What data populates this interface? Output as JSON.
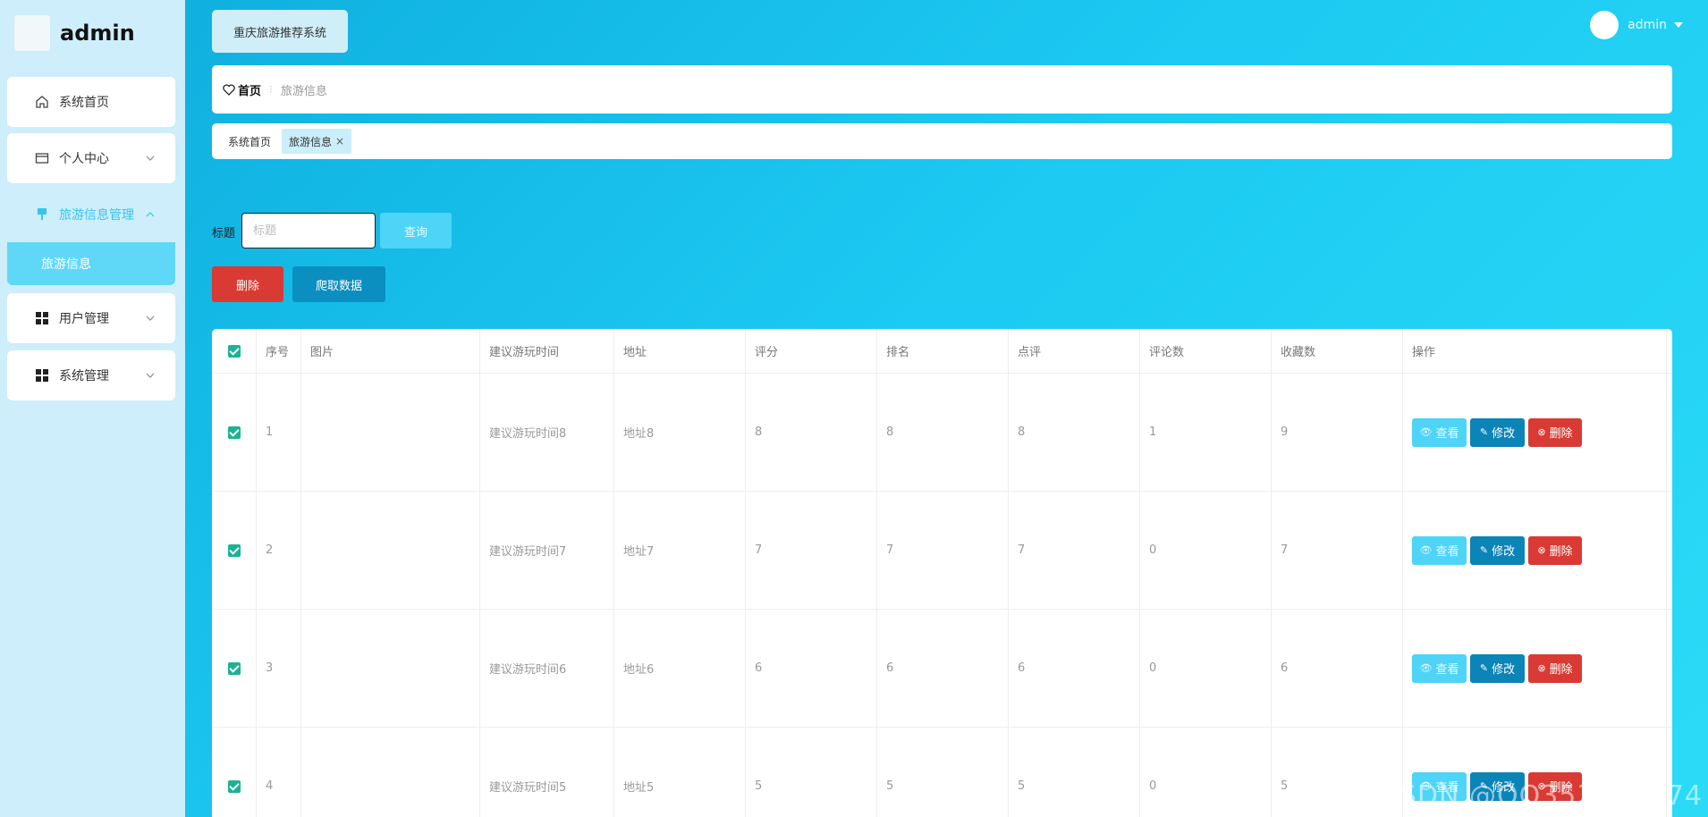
{
  "app": {
    "brand": "admin",
    "system_title": "重庆旅游推荐系统",
    "user_name": "admin"
  },
  "sidebar": {
    "items": [
      {
        "label": "系统首页",
        "icon": "home-icon"
      },
      {
        "label": "个人中心",
        "icon": "wallet-icon"
      },
      {
        "label": "旅游信息管理",
        "icon": "marker-icon"
      },
      {
        "label": "用户管理",
        "icon": "grid-icon"
      },
      {
        "label": "系统管理",
        "icon": "grid-icon"
      }
    ],
    "sub_item": "旅游信息"
  },
  "breadcrumb": {
    "home": "首页",
    "current": "旅游信息"
  },
  "tags": {
    "home": "系统首页",
    "active": "旅游信息",
    "close": "×"
  },
  "search": {
    "label": "标题",
    "placeholder": "标题",
    "query_btn": "查询"
  },
  "actions": {
    "delete": "删除",
    "crawl": "爬取数据"
  },
  "table": {
    "headers": [
      "序号",
      "图片",
      "建议游玩时间",
      "地址",
      "评分",
      "排名",
      "点评",
      "评论数",
      "收藏数",
      "操作"
    ],
    "rows": [
      {
        "idx": "1",
        "time": "建议游玩时间8",
        "addr": "地址8",
        "score": "8",
        "rank": "8",
        "review": "8",
        "comments": "1",
        "favs": "9"
      },
      {
        "idx": "2",
        "time": "建议游玩时间7",
        "addr": "地址7",
        "score": "7",
        "rank": "7",
        "review": "7",
        "comments": "0",
        "favs": "7"
      },
      {
        "idx": "3",
        "time": "建议游玩时间6",
        "addr": "地址6",
        "score": "6",
        "rank": "6",
        "review": "6",
        "comments": "0",
        "favs": "6"
      },
      {
        "idx": "4",
        "time": "建议游玩时间5",
        "addr": "地址5",
        "score": "5",
        "rank": "5",
        "review": "5",
        "comments": "0",
        "favs": "5"
      }
    ],
    "op_view": "查看",
    "op_edit": "修改",
    "op_delete": "删除"
  },
  "watermark": "CSDN @QQ353892174",
  "colors": {
    "primary": "#18c4f0",
    "danger": "#d93a33",
    "dark_blue": "#0b84b8",
    "check": "#1bb394"
  }
}
